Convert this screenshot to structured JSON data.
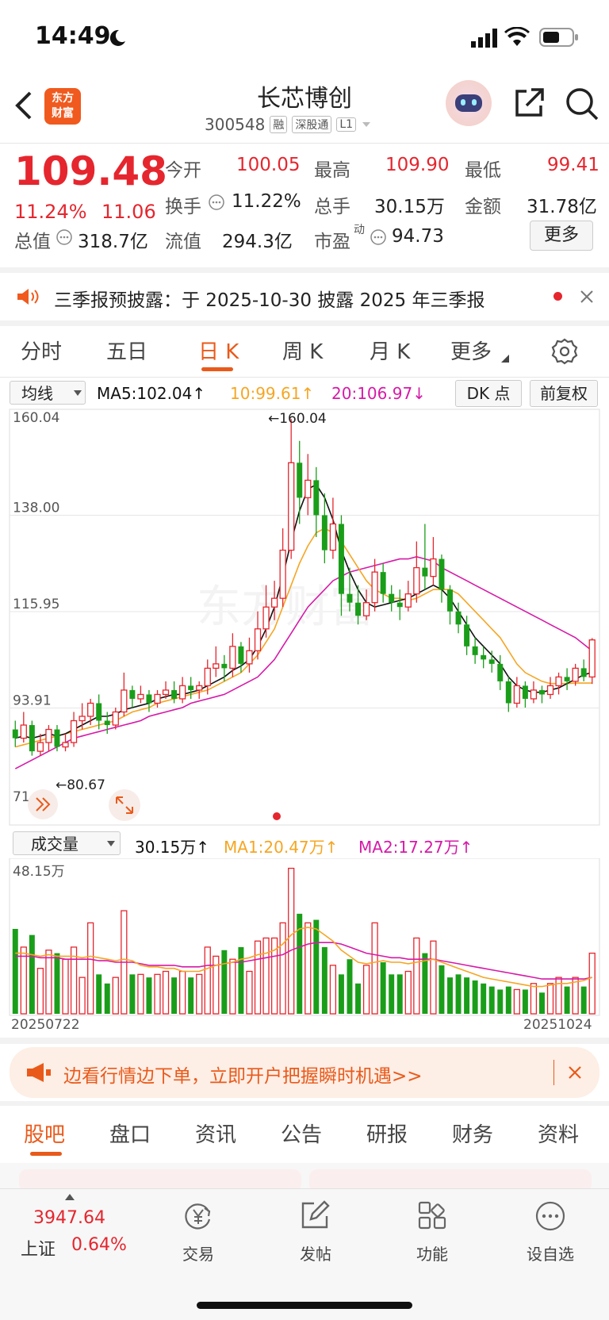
{
  "status_bar": {
    "time": "14:49"
  },
  "header": {
    "logo_text_line1": "东方",
    "logo_text_line2": "财富",
    "title": "长芯博创",
    "code": "300548",
    "tags": [
      "融",
      "深股通",
      "L1"
    ]
  },
  "quote": {
    "price": "109.48",
    "change_pct": "11.24%",
    "change": "11.06",
    "fields": [
      {
        "label": "今开",
        "value": "100.05"
      },
      {
        "label": "最高",
        "value": "109.90"
      },
      {
        "label": "最低",
        "value": "99.41"
      },
      {
        "label": "换手",
        "value": "11.22%"
      },
      {
        "label": "总手",
        "value": "30.15万"
      },
      {
        "label": "金额",
        "value": "31.78亿"
      },
      {
        "label": "总值",
        "value": "318.7亿"
      },
      {
        "label": "流值",
        "value": "294.3亿"
      },
      {
        "label": "市盈",
        "value": "94.73"
      }
    ],
    "pe_superscript": "动",
    "more_label": "更多"
  },
  "notice": {
    "text": "三季报预披露：于 2025-10-30 披露 2025 年三季报"
  },
  "period_tabs": [
    "分时",
    "五日",
    "日 K",
    "周 K",
    "月 K",
    "更多"
  ],
  "active_tab_index": 2,
  "chart_toolbar": {
    "indicator_select": "均线",
    "ma5": "MA5:102.04↑",
    "ma10": "10:99.61↑",
    "ma20": "20:106.97↓",
    "dk_label": "DK 点",
    "adjust_label": "前复权"
  },
  "price_axis": [
    "160.04",
    "138.00",
    "115.95",
    "93.91",
    "71.86"
  ],
  "annotations": {
    "high": "←160.04",
    "low": "←80.67"
  },
  "volume_toolbar": {
    "select": "成交量",
    "vol": "30.15万↑",
    "ma1": "MA1:20.47万↑",
    "ma2": "MA2:17.27万↑",
    "max_label": "48.15万"
  },
  "date_axis": {
    "start": "20250722",
    "end": "20251024"
  },
  "promo": {
    "text": "边看行情边下单，立即开户把握瞬时机遇>>"
  },
  "bottom_tabs": [
    "股吧",
    "盘口",
    "资讯",
    "公告",
    "研报",
    "财务",
    "资料"
  ],
  "bottom_nav": {
    "index_value": "3947.64",
    "index_name": "上证",
    "index_change": "0.64%",
    "items": [
      {
        "label": "交易",
        "icon": "yen-exchange-icon"
      },
      {
        "label": "发帖",
        "icon": "edit-icon"
      },
      {
        "label": "功能",
        "icon": "grid-icon"
      },
      {
        "label": "设自选",
        "icon": "more-dots-icon"
      }
    ]
  },
  "colors": {
    "up": "#e5262e",
    "down": "#1a9e1a",
    "ma5": "#111111",
    "ma10": "#f5a623",
    "ma20": "#d61aa8",
    "accent": "#e95a1a"
  },
  "chart_data": {
    "type": "candlestick",
    "date_range": [
      "20250722",
      "20251024"
    ],
    "ylim": [
      71.86,
      160.04
    ],
    "y_ticks": [
      160.04,
      138.0,
      115.95,
      93.91,
      71.86
    ],
    "high_marker": 160.04,
    "low_marker": 80.67,
    "candles": [
      [
        89,
        87,
        91,
        85
      ],
      [
        87,
        90,
        93,
        86
      ],
      [
        90,
        84,
        91,
        83
      ],
      [
        84,
        86,
        88,
        83
      ],
      [
        86,
        89,
        90,
        84
      ],
      [
        89,
        85,
        90,
        84
      ],
      [
        85,
        86,
        88,
        84
      ],
      [
        86,
        91,
        93,
        85
      ],
      [
        91,
        92,
        95,
        89
      ],
      [
        92,
        95,
        96,
        90
      ],
      [
        95,
        91,
        97,
        89
      ],
      [
        91,
        90,
        93,
        88
      ],
      [
        90,
        93,
        94,
        89
      ],
      [
        93,
        98,
        102,
        92
      ],
      [
        98,
        96,
        99,
        94
      ],
      [
        96,
        97,
        99,
        95
      ],
      [
        97,
        95,
        98,
        93
      ],
      [
        95,
        97,
        98,
        94
      ],
      [
        97,
        98,
        100,
        96
      ],
      [
        98,
        96,
        100,
        95
      ],
      [
        96,
        99,
        101,
        95
      ],
      [
        99,
        98,
        101,
        96
      ],
      [
        98,
        99,
        100,
        96
      ],
      [
        99,
        103,
        105,
        97
      ],
      [
        103,
        104,
        108,
        101
      ],
      [
        104,
        103,
        106,
        100
      ],
      [
        103,
        108,
        111,
        101
      ],
      [
        108,
        104,
        109,
        102
      ],
      [
        104,
        107,
        110,
        102
      ],
      [
        107,
        112,
        116,
        105
      ],
      [
        112,
        117,
        122,
        110
      ],
      [
        117,
        119,
        123,
        114
      ],
      [
        119,
        130,
        135,
        117
      ],
      [
        130,
        150,
        160,
        128
      ],
      [
        150,
        142,
        155,
        136
      ],
      [
        142,
        146,
        152,
        138
      ],
      [
        146,
        138,
        149,
        133
      ],
      [
        138,
        130,
        143,
        127
      ],
      [
        130,
        136,
        142,
        128
      ],
      [
        136,
        120,
        138,
        115
      ],
      [
        120,
        118,
        126,
        116
      ],
      [
        118,
        115,
        122,
        113
      ],
      [
        115,
        118,
        121,
        114
      ],
      [
        118,
        125,
        128,
        116
      ],
      [
        125,
        120,
        127,
        118
      ],
      [
        120,
        118,
        122,
        116
      ],
      [
        118,
        117,
        121,
        114
      ],
      [
        117,
        120,
        123,
        116
      ],
      [
        120,
        126,
        132,
        118
      ],
      [
        126,
        124,
        136,
        121
      ],
      [
        124,
        128,
        133,
        122
      ],
      [
        128,
        121,
        129,
        118
      ],
      [
        121,
        116,
        122,
        113
      ],
      [
        116,
        113,
        118,
        111
      ],
      [
        113,
        108,
        115,
        106
      ],
      [
        108,
        106,
        110,
        104
      ],
      [
        106,
        105,
        108,
        103
      ],
      [
        105,
        104,
        107,
        102
      ],
      [
        104,
        100,
        106,
        98
      ],
      [
        100,
        95,
        101,
        93
      ],
      [
        95,
        99,
        101,
        94
      ],
      [
        99,
        96,
        100,
        94
      ],
      [
        96,
        98,
        100,
        95
      ],
      [
        98,
        97,
        99,
        95
      ],
      [
        97,
        99,
        101,
        96
      ],
      [
        99,
        101,
        102,
        97
      ],
      [
        101,
        100,
        103,
        98
      ],
      [
        100,
        103,
        104,
        99
      ],
      [
        103,
        101,
        105,
        100
      ],
      [
        101,
        109.48,
        109.9,
        99.41
      ]
    ],
    "ma5": [
      87,
      87.5,
      87,
      87.5,
      88,
      87.5,
      88,
      89,
      90,
      91,
      92,
      92,
      92.5,
      93.5,
      94,
      94.5,
      95,
      96,
      96.5,
      97,
      97,
      97.5,
      98,
      99,
      100,
      101,
      102.5,
      103.5,
      105,
      108,
      112,
      117,
      124,
      132,
      139,
      144,
      145,
      142,
      137,
      130,
      125,
      121,
      118,
      117,
      117.5,
      118,
      118.5,
      119,
      120,
      121,
      122,
      121,
      119,
      116,
      113,
      110,
      108,
      106,
      104,
      101,
      99,
      98,
      97.5,
      97.5,
      98,
      98.5,
      99.5,
      100.5,
      101.5,
      102.04
    ],
    "ma10": [
      85,
      85.5,
      86,
      86.5,
      87,
      87.5,
      88,
      88.5,
      89,
      89.5,
      90,
      90.5,
      91,
      92,
      93,
      93.5,
      94,
      95,
      95.5,
      96,
      96.5,
      97,
      97.5,
      98,
      99,
      100,
      101,
      102,
      104,
      106,
      109,
      112,
      117,
      122,
      127,
      131,
      134,
      135,
      134,
      132,
      129,
      126,
      123,
      121,
      120,
      119,
      119,
      118.5,
      119,
      120,
      121,
      121,
      121,
      120,
      118,
      116,
      114,
      112,
      110,
      107,
      104,
      102,
      101,
      100,
      99.5,
      99.5,
      99.5,
      99.6,
      99.6,
      99.61
    ],
    "ma20": [
      80,
      81,
      82,
      83,
      84,
      85,
      86,
      87,
      87.5,
      88,
      88.5,
      89,
      89.5,
      90,
      90.5,
      91,
      92,
      92.5,
      93,
      93.5,
      94,
      95,
      95.5,
      96,
      96.5,
      97,
      98,
      99,
      100,
      101,
      103,
      105,
      108,
      111,
      114,
      117,
      119,
      121,
      123,
      124,
      125,
      125.5,
      126,
      126.5,
      127,
      127.5,
      128,
      128,
      128.5,
      128,
      127.5,
      126,
      125,
      124,
      123,
      122,
      121,
      120,
      119,
      118,
      117,
      116,
      115,
      114,
      113,
      112,
      111,
      110,
      108.5,
      106.97
    ],
    "volume": {
      "max_label": "48.15万",
      "values": [
        28,
        22,
        26,
        15,
        21,
        20,
        18,
        22,
        12,
        30,
        13,
        10,
        12,
        34,
        13,
        13,
        12,
        13,
        14,
        12,
        14,
        12,
        13,
        22,
        19,
        21,
        18,
        22,
        14,
        24,
        25,
        25,
        30,
        48,
        33,
        30,
        31,
        22,
        16,
        13,
        18,
        10,
        16,
        30,
        17,
        13,
        13,
        14,
        25,
        20,
        24,
        16,
        12,
        13,
        12,
        11,
        10,
        9,
        8,
        9,
        8,
        8,
        10,
        7,
        10,
        12,
        9,
        12,
        9,
        20
      ],
      "ma1": [
        20,
        20,
        19.5,
        19,
        19.5,
        19,
        19,
        19,
        18.5,
        19,
        18.5,
        18,
        17.5,
        18,
        17.5,
        16,
        15.5,
        15.5,
        15,
        15,
        14,
        14,
        14,
        15,
        16,
        16.5,
        17,
        18,
        18.5,
        19.5,
        20,
        21,
        23,
        26,
        28,
        28.5,
        28,
        26,
        24,
        21,
        19,
        17,
        16.5,
        17,
        17.5,
        17,
        17,
        16.5,
        17,
        17.5,
        18,
        17,
        16,
        15,
        14,
        13,
        12,
        11.5,
        11,
        10.5,
        10,
        9.5,
        9,
        9,
        9.5,
        10,
        10,
        10.5,
        11,
        12
      ],
      "ma2": [
        19,
        19,
        19,
        18.5,
        18.5,
        18.5,
        18,
        18,
        18,
        18,
        17.5,
        17.5,
        17,
        17,
        17,
        16.5,
        16,
        16,
        16,
        16,
        15.5,
        15.5,
        15.5,
        16,
        16,
        16.5,
        17,
        17,
        17.5,
        18,
        18.5,
        19,
        19.5,
        21,
        22,
        23,
        23.5,
        23.5,
        23.5,
        23,
        22,
        21,
        20,
        19.5,
        19,
        18.5,
        18.5,
        18,
        18,
        18,
        18,
        17.5,
        17,
        16.5,
        16,
        15.5,
        15,
        14.5,
        14,
        13.5,
        13,
        12.5,
        12,
        11.5,
        11.5,
        11.5,
        11.5,
        11.5,
        11.5,
        12
      ]
    }
  }
}
